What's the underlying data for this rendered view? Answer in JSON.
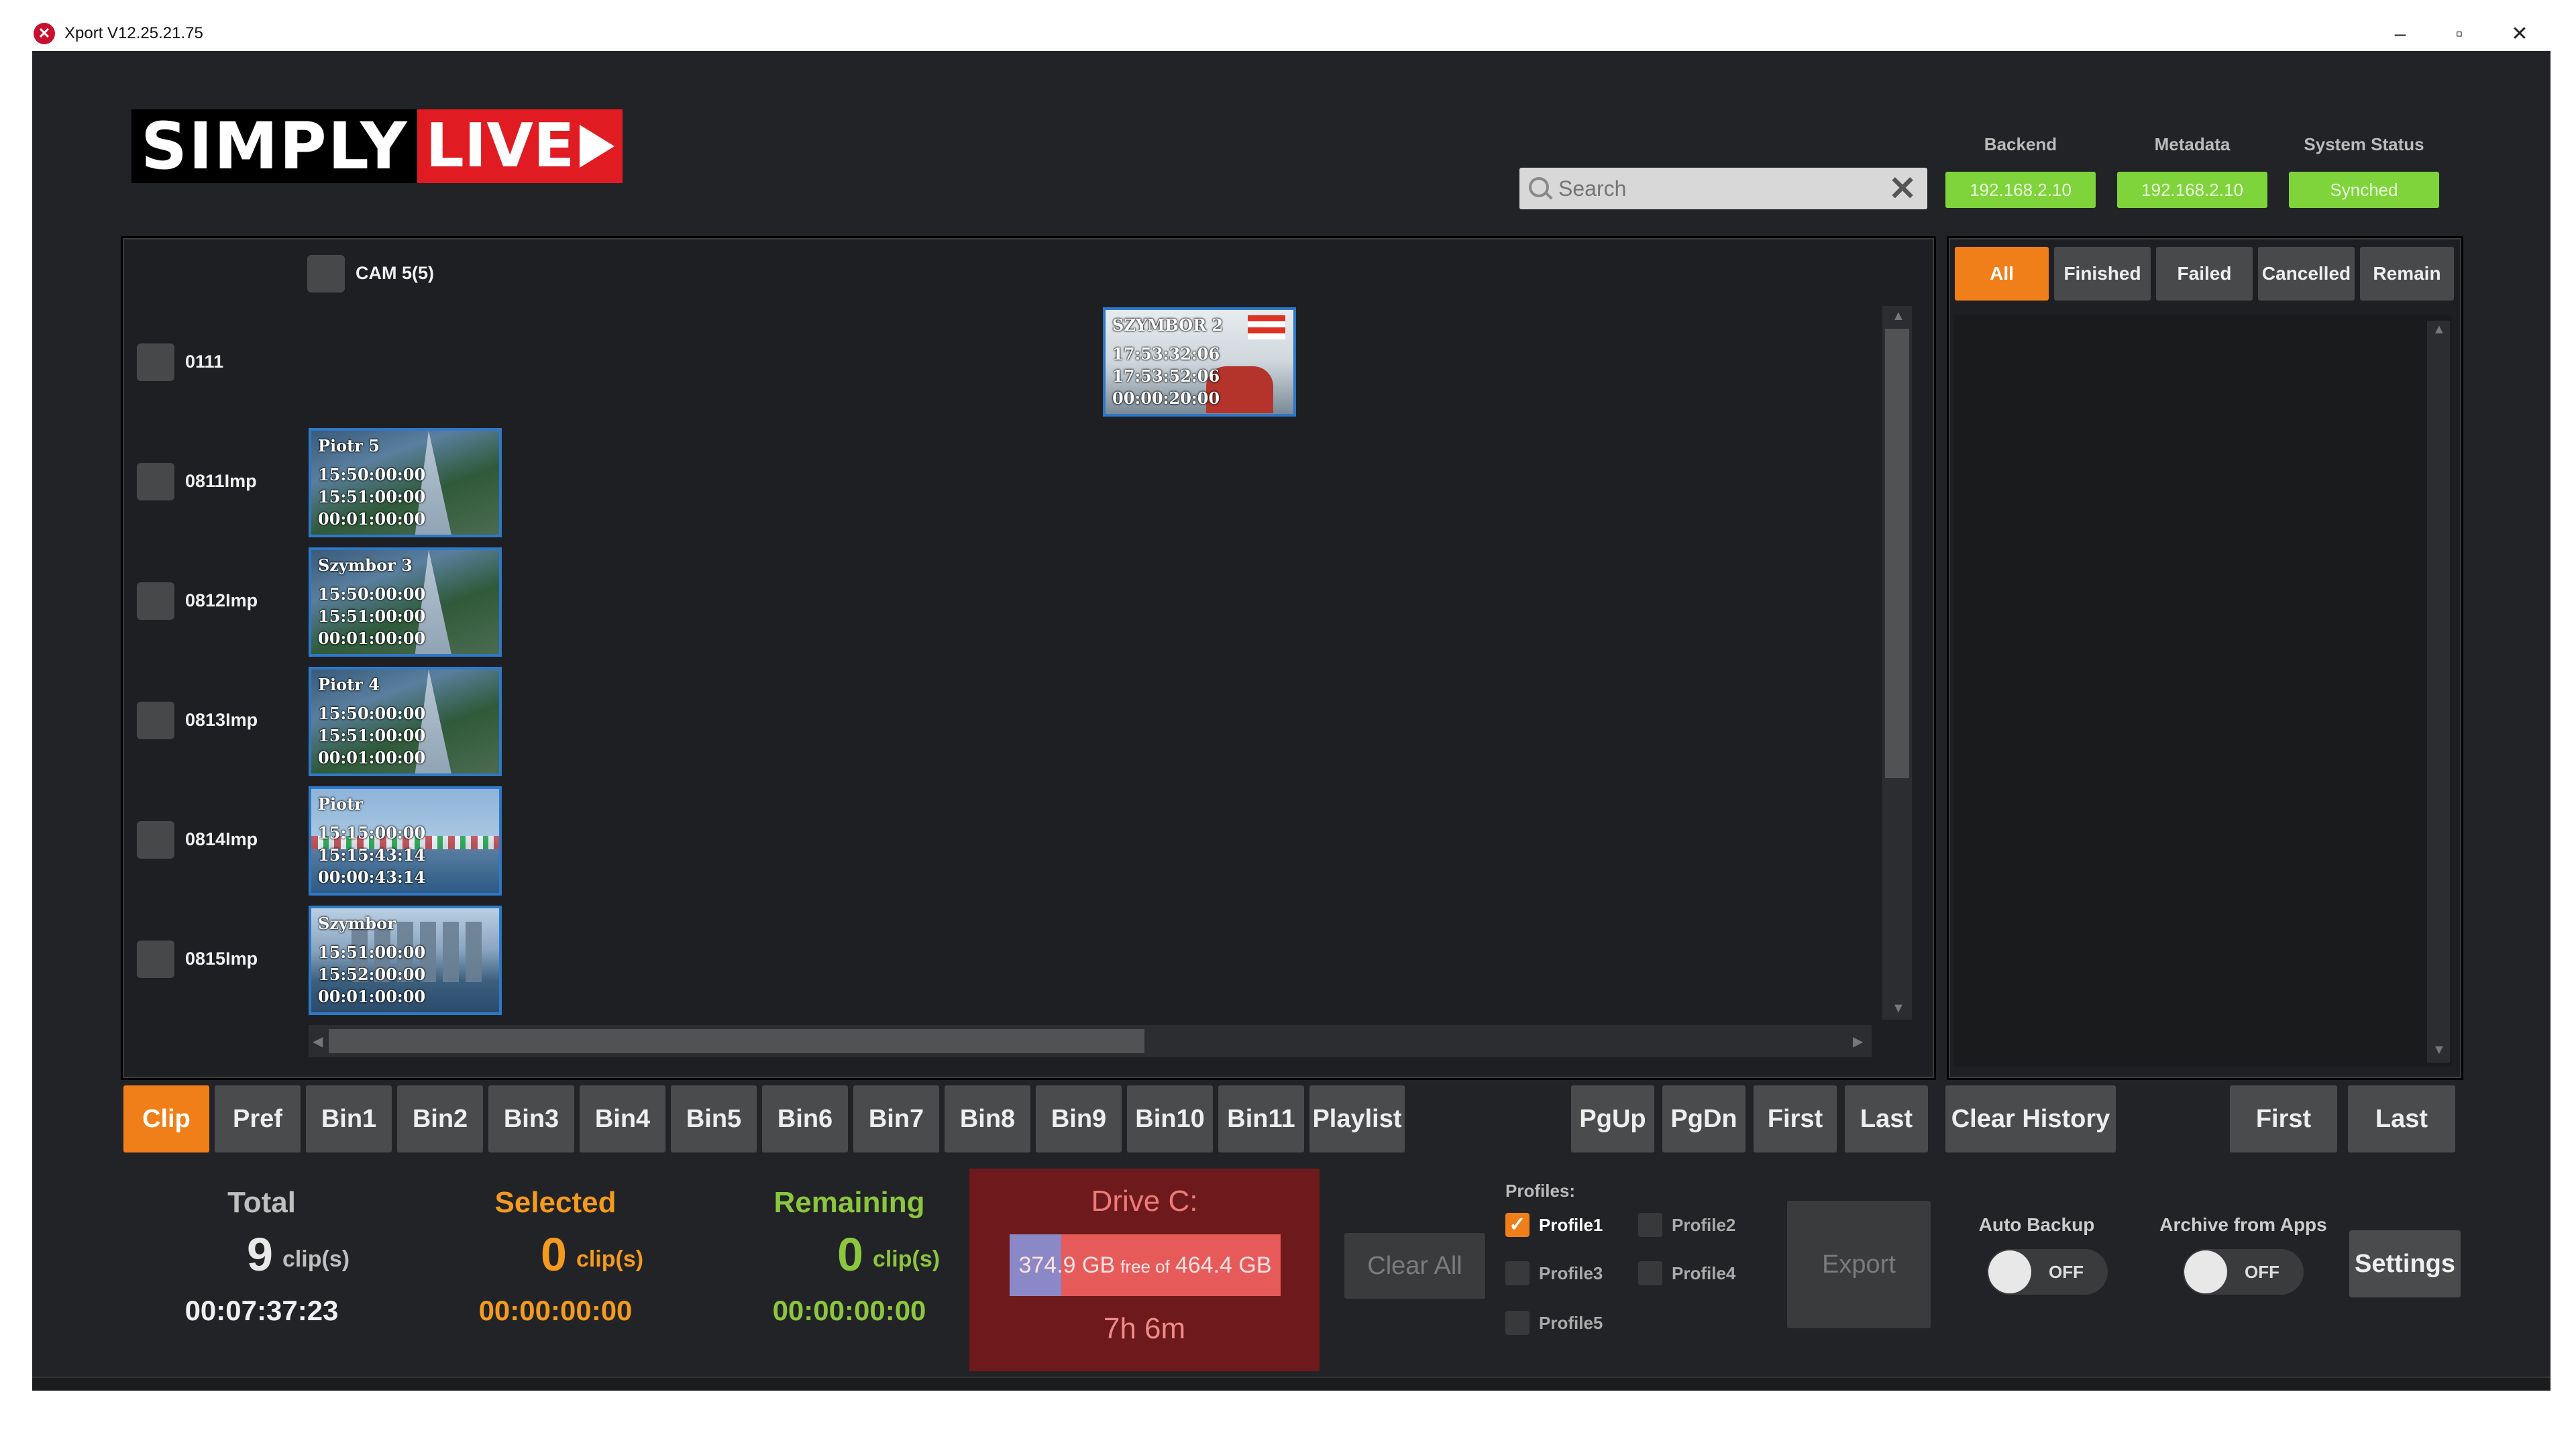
{
  "window": {
    "title": "Xport V12.25.21.75",
    "minimize": "–",
    "maximize": "▫",
    "close": "✕"
  },
  "logo": {
    "left_text": "SIMPLY",
    "right_text": "LIVE"
  },
  "search": {
    "placeholder": "Search",
    "value": ""
  },
  "status": {
    "backend": {
      "label": "Backend",
      "value": "192.168.2.10"
    },
    "metadata": {
      "label": "Metadata",
      "value": "192.168.2.10"
    },
    "system": {
      "label": "System Status",
      "value": "Synched"
    },
    "color": "#7fd33b"
  },
  "camera_header": {
    "label": "CAM 5(5)"
  },
  "rows": [
    {
      "label": "0111"
    },
    {
      "label": "0811Imp"
    },
    {
      "label": "0812Imp"
    },
    {
      "label": "0813Imp"
    },
    {
      "label": "0814Imp"
    },
    {
      "label": "0815Imp"
    }
  ],
  "clips": [
    {
      "name": "SZYMBOR 2",
      "in": "17:53:32:06",
      "out": "17:53:52:06",
      "duration": "00:00:20:00"
    },
    {
      "name": "Piotr 5",
      "in": "15:50:00:00",
      "out": "15:51:00:00",
      "duration": "00:01:00:00"
    },
    {
      "name": "Szymbor 3",
      "in": "15:50:00:00",
      "out": "15:51:00:00",
      "duration": "00:01:00:00"
    },
    {
      "name": "Piotr 4",
      "in": "15:50:00:00",
      "out": "15:51:00:00",
      "duration": "00:01:00:00"
    },
    {
      "name": "Piotr",
      "in": "15:15:00:00",
      "out": "15:15:43:14",
      "duration": "00:00:43:14"
    },
    {
      "name": "Szymbor",
      "in": "15:51:00:00",
      "out": "15:52:00:00",
      "duration": "00:01:00:00"
    }
  ],
  "filters": [
    "All",
    "Finished",
    "Failed",
    "Cancelled",
    "Remain"
  ],
  "tabs": [
    "Clip",
    "Pref",
    "Bin1",
    "Bin2",
    "Bin3",
    "Bin4",
    "Bin5",
    "Bin6",
    "Bin7",
    "Bin8",
    "Bin9",
    "Bin10",
    "Bin11",
    "Playlist"
  ],
  "paging": {
    "pgup": "PgUp",
    "pgdn": "PgDn",
    "first": "First",
    "last": "Last"
  },
  "history": {
    "clear": "Clear History",
    "first": "First",
    "last": "Last"
  },
  "stats": {
    "total": {
      "title": "Total",
      "count": "9",
      "unit": "clip(s)",
      "time": "00:07:37:23",
      "color": "#bfbfbf"
    },
    "selected": {
      "title": "Selected",
      "count": "0",
      "unit": "clip(s)",
      "time": "00:00:00:00",
      "color": "#f39a1f"
    },
    "remaining": {
      "title": "Remaining",
      "count": "0",
      "unit": "clip(s)",
      "time": "00:00:00:00",
      "color": "#8cc63f"
    }
  },
  "drive": {
    "title": "Drive C:",
    "free": "374.9 GB",
    "free_of": "free of",
    "total": "464.4 GB",
    "used_fraction": 0.19,
    "time_left": "7h 6m"
  },
  "actions": {
    "clear_all": "Clear All",
    "export": "Export",
    "settings": "Settings"
  },
  "profiles": {
    "label": "Profiles:",
    "items": [
      {
        "name": "Profile1",
        "checked": true
      },
      {
        "name": "Profile2",
        "checked": false
      },
      {
        "name": "Profile3",
        "checked": false
      },
      {
        "name": "Profile4",
        "checked": false
      },
      {
        "name": "Profile5",
        "checked": false
      }
    ],
    "check_mark": "✓"
  },
  "toggles": {
    "auto_backup": {
      "label": "Auto Backup",
      "state": "OFF"
    },
    "archive": {
      "label": "Archive from Apps",
      "state": "OFF"
    }
  },
  "colors": {
    "accent": "#f07f1a",
    "drive_bg": "#6e1a1c",
    "clip_border": "#2e78c7"
  }
}
